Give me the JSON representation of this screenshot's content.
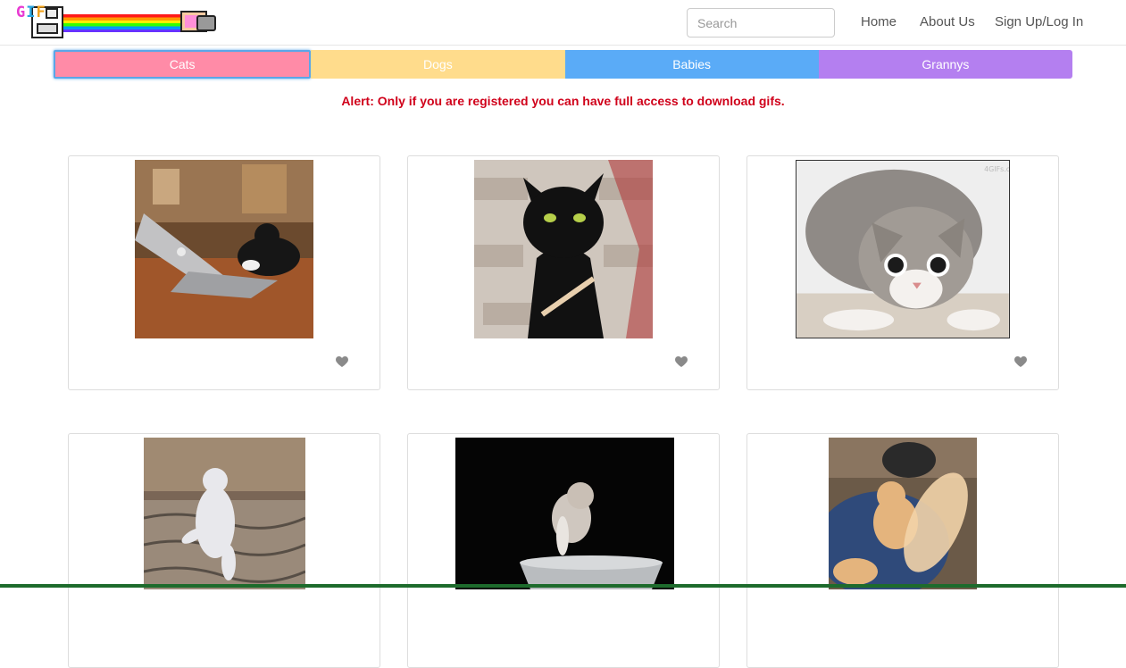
{
  "header": {
    "logo_text": [
      "G",
      "I",
      "F"
    ],
    "search_placeholder": "Search",
    "nav": [
      "Home",
      "About Us",
      "Sign Up/Log In"
    ]
  },
  "categories": [
    {
      "label": "Cats",
      "color": "#ff8ba7",
      "active": true
    },
    {
      "label": "Dogs",
      "color": "#ffdc8c"
    },
    {
      "label": "Babies",
      "color": "#5aabf7"
    },
    {
      "label": "Grannys",
      "color": "#b47ff0"
    }
  ],
  "alert": "Alert: Only if you are registered you can have full access to download gifs.",
  "gifs": [
    {
      "subject": "cat typing on laptop"
    },
    {
      "subject": "black cat with nail file"
    },
    {
      "subject": "tabby cat crouching",
      "watermark": "4GIFs.com"
    },
    {
      "subject": "white cat dancing on rug"
    },
    {
      "subject": "kitten in bucket"
    },
    {
      "subject": "orange cat punching"
    }
  ],
  "colors": {
    "alert": "#d0021b",
    "heart": "#8a8a8a"
  }
}
